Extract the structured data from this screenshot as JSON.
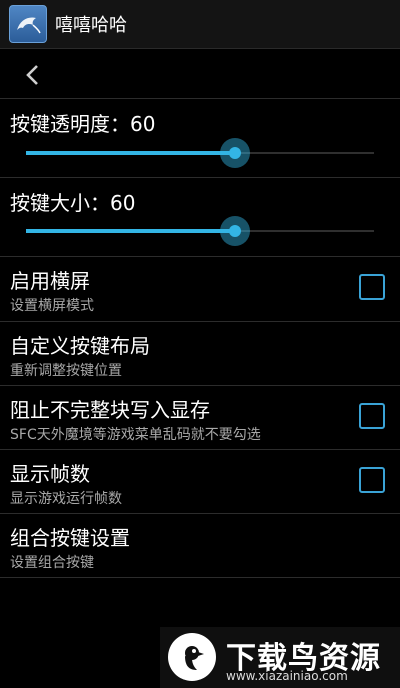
{
  "app": {
    "title": "嘻嘻哈哈",
    "icon": "mysql-dolphin-icon"
  },
  "back": {
    "icon": "chevron-left-icon"
  },
  "sliders": [
    {
      "label": "按键透明度：60",
      "value": 60,
      "max": 100
    },
    {
      "label": "按键大小：60",
      "value": 60,
      "max": 100
    }
  ],
  "prefs": [
    {
      "title": "启用横屏",
      "subtitle": "设置横屏模式",
      "checkbox": true,
      "checked": false
    },
    {
      "title": "自定义按键布局",
      "subtitle": "重新调整按键位置",
      "checkbox": false
    },
    {
      "title": "阻止不完整块写入显存",
      "subtitle": "SFC天外魔境等游戏菜单乱码就不要勾选",
      "checkbox": true,
      "checked": false
    },
    {
      "title": "显示帧数",
      "subtitle": "显示游戏运行帧数",
      "checkbox": true,
      "checked": false
    },
    {
      "title": "组合按键设置",
      "subtitle": "设置组合按键",
      "checkbox": false
    }
  ],
  "watermark": {
    "brand": "下载鸟资源",
    "url": "www.xiazainiao.com"
  },
  "colors": {
    "accent": "#33b5e5",
    "checkbox_border": "#3aa3d6",
    "background": "#000000"
  }
}
